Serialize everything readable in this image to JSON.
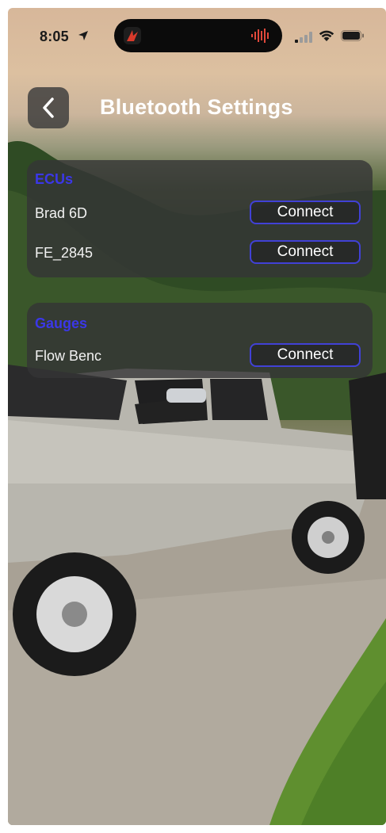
{
  "status_bar": {
    "time": "8:05",
    "location_icon": "location-arrow-icon",
    "signal_icon": "cellular-signal-icon",
    "wifi_icon": "wifi-icon",
    "battery_icon": "battery-icon"
  },
  "header": {
    "back_icon": "chevron-left-icon",
    "title": "Bluetooth Settings"
  },
  "sections": {
    "ecus": {
      "title": "ECUs",
      "devices": [
        {
          "name": "Brad 6D",
          "action": "Connect"
        },
        {
          "name": "FE_2845",
          "action": "Connect"
        }
      ]
    },
    "gauges": {
      "title": "Gauges",
      "devices": [
        {
          "name": "Flow Benc",
          "action": "Connect"
        }
      ]
    }
  },
  "colors": {
    "section_title": "#3b37e8",
    "button_border": "#4141d6",
    "panel_bg": "#343436"
  }
}
